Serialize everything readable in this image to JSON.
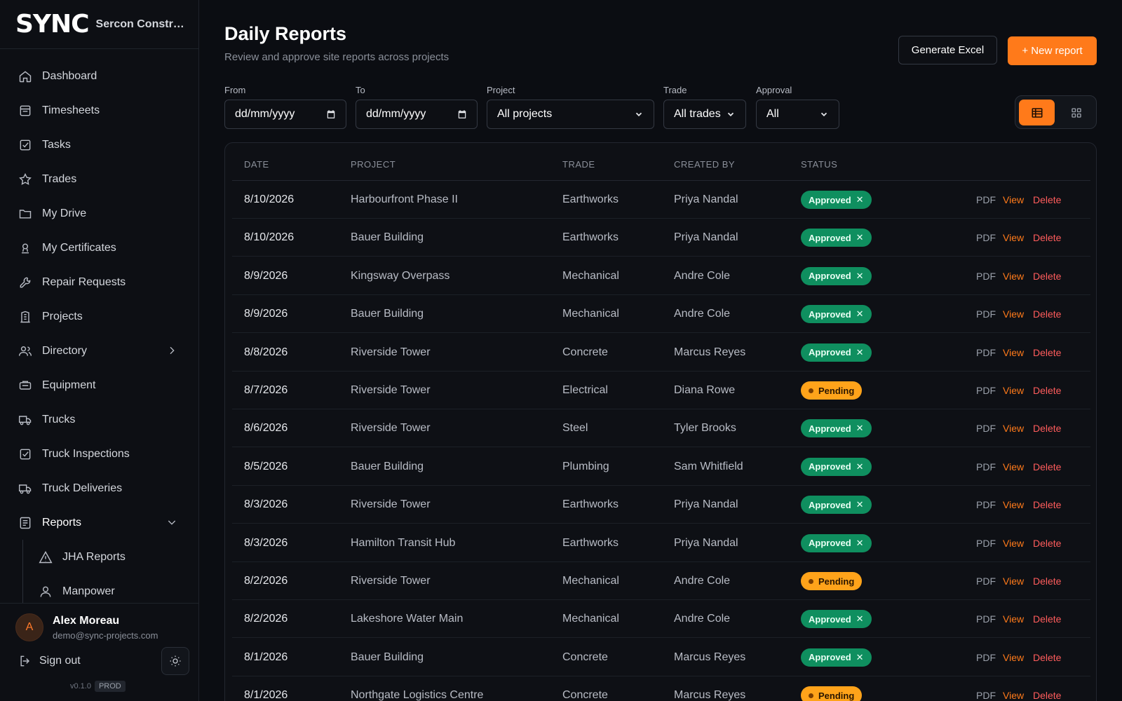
{
  "brand": {
    "logo": "SYNC",
    "company": "Sercon Construction"
  },
  "sidebar": {
    "items": [
      {
        "label": "Dashboard",
        "icon": "home-icon"
      },
      {
        "label": "Timesheets",
        "icon": "calendar-icon"
      },
      {
        "label": "Tasks",
        "icon": "checkbox-icon"
      },
      {
        "label": "Trades",
        "icon": "star-icon"
      },
      {
        "label": "My Drive",
        "icon": "folder-icon"
      },
      {
        "label": "My Certificates",
        "icon": "certificate-icon"
      },
      {
        "label": "Repair Requests",
        "icon": "wrench-icon"
      },
      {
        "label": "Projects",
        "icon": "building-icon"
      },
      {
        "label": "Directory",
        "icon": "users-icon"
      },
      {
        "label": "Equipment",
        "icon": "equipment-icon"
      },
      {
        "label": "Trucks",
        "icon": "truck-icon"
      },
      {
        "label": "Truck Inspections",
        "icon": "checkbox-icon"
      },
      {
        "label": "Truck Deliveries",
        "icon": "truck-icon"
      },
      {
        "label": "Reports",
        "icon": "report-icon"
      }
    ],
    "subitems": [
      {
        "label": "JHA Reports",
        "icon": "warning-icon"
      },
      {
        "label": "Manpower",
        "icon": "user-icon"
      }
    ]
  },
  "user": {
    "initial": "A",
    "name": "Alex Moreau",
    "email": "demo@sync-projects.com",
    "signout": "Sign out",
    "version": "v0.1.0",
    "env": "PROD"
  },
  "page": {
    "title": "Daily Reports",
    "subtitle": "Review and approve site reports across projects",
    "export_label": "Generate Excel",
    "new_label": "+ New report"
  },
  "filters": {
    "from": {
      "label": "From",
      "value": "dd/mm/yyyy"
    },
    "to": {
      "label": "To",
      "value": "dd/mm/yyyy"
    },
    "project": {
      "label": "Project",
      "value": "All projects"
    },
    "trade": {
      "label": "Trade",
      "value": "All trades"
    },
    "approval": {
      "label": "Approval",
      "value": "All"
    }
  },
  "table": {
    "columns": [
      "DATE",
      "PROJECT",
      "TRADE",
      "CREATED BY",
      "STATUS"
    ],
    "actions": {
      "pdf": "PDF",
      "view": "View",
      "delete": "Delete"
    },
    "rows": [
      {
        "date": "8/10/2026",
        "project": "Harbourfront Phase II",
        "trade": "Earthworks",
        "created_by": "Priya Nandal",
        "status": "Approved"
      },
      {
        "date": "8/10/2026",
        "project": "Bauer Building",
        "trade": "Earthworks",
        "created_by": "Priya Nandal",
        "status": "Approved"
      },
      {
        "date": "8/9/2026",
        "project": "Kingsway Overpass",
        "trade": "Mechanical",
        "created_by": "Andre Cole",
        "status": "Approved"
      },
      {
        "date": "8/9/2026",
        "project": "Bauer Building",
        "trade": "Mechanical",
        "created_by": "Andre Cole",
        "status": "Approved"
      },
      {
        "date": "8/8/2026",
        "project": "Riverside Tower",
        "trade": "Concrete",
        "created_by": "Marcus Reyes",
        "status": "Approved"
      },
      {
        "date": "8/7/2026",
        "project": "Riverside Tower",
        "trade": "Electrical",
        "created_by": "Diana Rowe",
        "status": "Pending"
      },
      {
        "date": "8/6/2026",
        "project": "Riverside Tower",
        "trade": "Steel",
        "created_by": "Tyler Brooks",
        "status": "Approved"
      },
      {
        "date": "8/5/2026",
        "project": "Bauer Building",
        "trade": "Plumbing",
        "created_by": "Sam Whitfield",
        "status": "Approved"
      },
      {
        "date": "8/3/2026",
        "project": "Riverside Tower",
        "trade": "Earthworks",
        "created_by": "Priya Nandal",
        "status": "Approved"
      },
      {
        "date": "8/3/2026",
        "project": "Hamilton Transit Hub",
        "trade": "Earthworks",
        "created_by": "Priya Nandal",
        "status": "Approved"
      },
      {
        "date": "8/2/2026",
        "project": "Riverside Tower",
        "trade": "Mechanical",
        "created_by": "Andre Cole",
        "status": "Pending"
      },
      {
        "date": "8/2/2026",
        "project": "Lakeshore Water Main",
        "trade": "Mechanical",
        "created_by": "Andre Cole",
        "status": "Approved"
      },
      {
        "date": "8/1/2026",
        "project": "Bauer Building",
        "trade": "Concrete",
        "created_by": "Marcus Reyes",
        "status": "Approved"
      },
      {
        "date": "8/1/2026",
        "project": "Northgate Logistics Centre",
        "trade": "Concrete",
        "created_by": "Marcus Reyes",
        "status": "Pending"
      }
    ]
  },
  "colors": {
    "accent": "#ff7a1a",
    "approved": "#0f8f5f",
    "pending": "#ffa31a",
    "danger": "#ff5c5c",
    "background": "#0b0d12"
  }
}
